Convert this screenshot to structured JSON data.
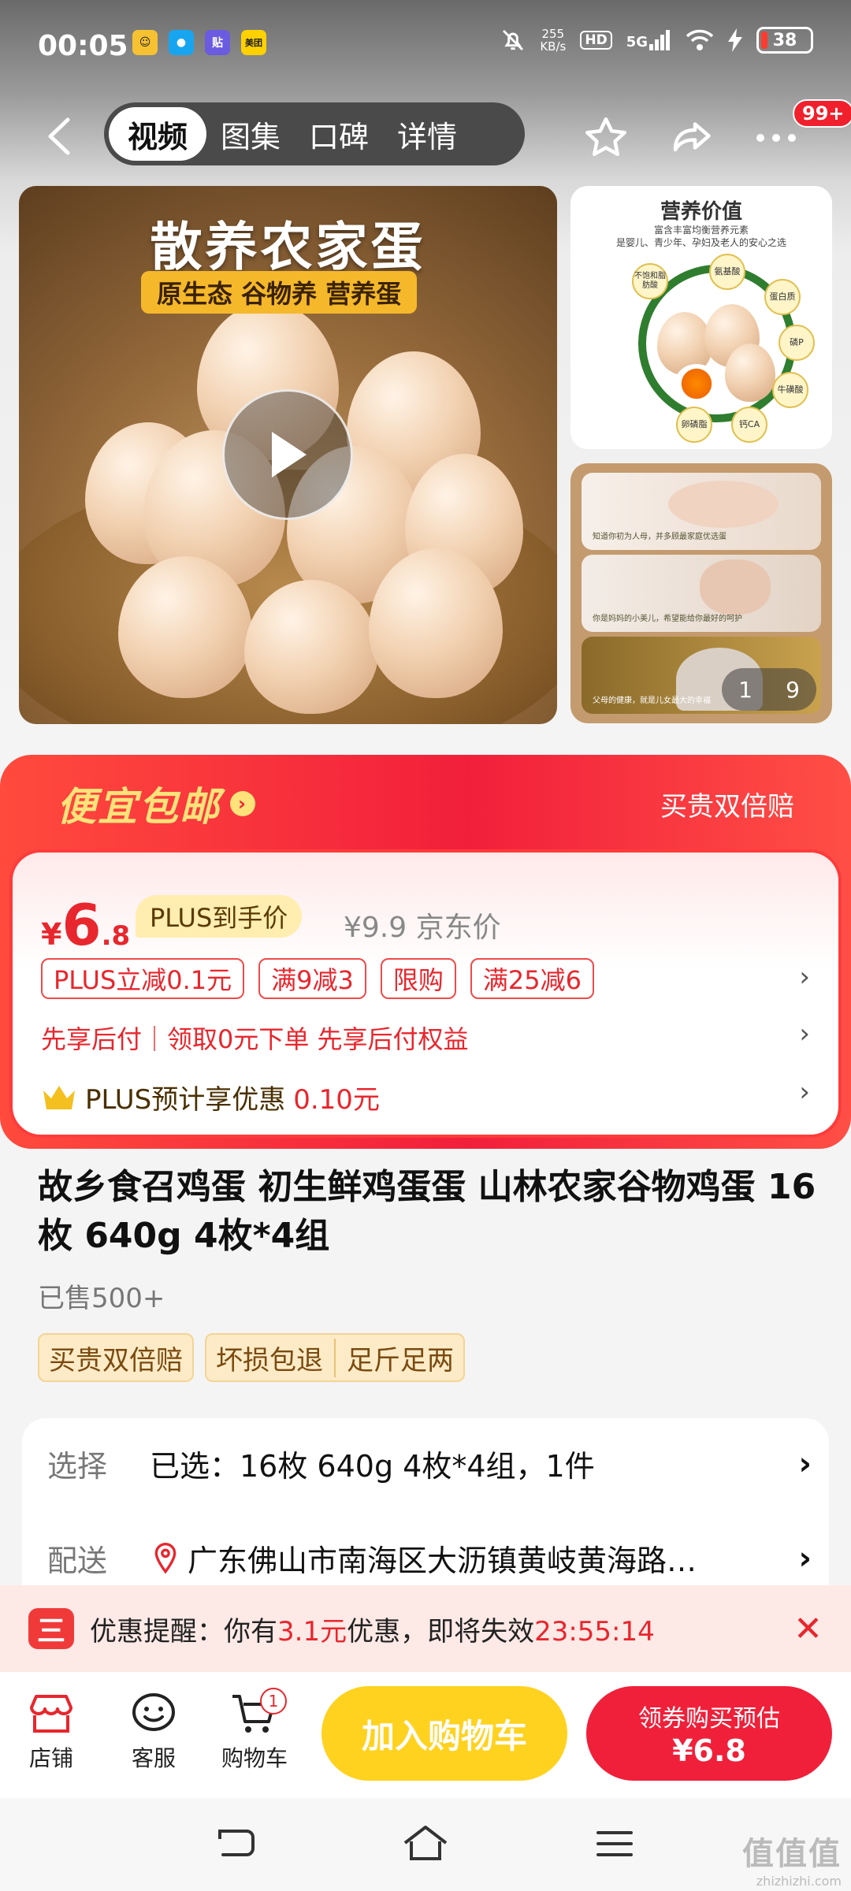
{
  "status_bar": {
    "time": "00:05",
    "apps": [
      {
        "icon": "face-app-icon",
        "glyph": "☺",
        "color": "#f7c231"
      },
      {
        "icon": "penguin-app-icon",
        "glyph": "●",
        "color": "#18a5f0"
      },
      {
        "icon": "tie-app-icon",
        "glyph": "贴",
        "color": "#6a5be0"
      },
      {
        "icon": "meituan-app-icon",
        "glyph": "美团",
        "color": "#ffd100"
      }
    ],
    "net_speed": "255",
    "net_unit": "KB/s",
    "hd": "HD",
    "signal": "5G",
    "battery": "38"
  },
  "header": {
    "tabs": [
      "视频",
      "图集",
      "口碑",
      "详情"
    ],
    "active_tab": 0,
    "badge": "99+"
  },
  "gallery": {
    "main_title": "散养农家蛋",
    "main_subtitle": "原生态 谷物养 营养蛋",
    "side1_title": "营养价值",
    "side1_sub1": "富含丰富均衡营养元素",
    "side1_sub2": "是婴儿、青少年、孕妇及老人的安心之选",
    "nutrients": [
      "氨基酸",
      "蛋白质",
      "磷P",
      "牛磺酸",
      "钙CA",
      "卵磷脂",
      "不饱和脂肪酸"
    ],
    "panel_texts": [
      "知道你初为人母，并多顾最家庭优选蛋",
      "你是妈妈的小美儿，希望能给你最好的呵护",
      "父母的健康，就是儿女最大的幸福"
    ],
    "counter_current": "1",
    "counter_total": "9"
  },
  "promo": {
    "title": "便宜包邮",
    "right_text": "买贵双倍赔"
  },
  "price": {
    "currency": "¥",
    "integer": "6",
    "decimal": ".8",
    "plus_label": "PLUS到手价",
    "jd_price": "¥9.9 京东价",
    "chips": [
      "PLUS立减0.1元",
      "满9减3",
      "限购",
      "满25减6"
    ],
    "bnpl": "先享后付｜领取0元下单 先享后付权益",
    "plus_save_prefix": "PLUS预计享优惠",
    "plus_save_amount": "0.10元"
  },
  "product": {
    "title": "故乡食召鸡蛋 初生鲜鸡蛋蛋 山林农家谷物鸡蛋 16枚 640g 4枚*4组",
    "sold": "已售500+",
    "tags": [
      "买贵双倍赔",
      "坏损包退",
      "足斤足两"
    ]
  },
  "spec": {
    "select_label": "选择",
    "select_value": "已选：16枚 640g 4枚*4组，1件",
    "ship_label": "配送",
    "ship_value": "广东佛山市南海区大沥镇黄岐黄海路…"
  },
  "reminder": {
    "icon_glyph": "三",
    "prefix": "优惠提醒：你有",
    "amount": "3.1元",
    "middle": "优惠，即将失效",
    "countdown": "23:55:14"
  },
  "bottom_bar": {
    "store": "店铺",
    "service": "客服",
    "cart": "购物车",
    "cart_count": "1",
    "add_to_cart": "加入购物车",
    "buy_line1": "领券购买预估",
    "buy_line2": "¥6.8"
  },
  "watermark": {
    "logo": "值值值",
    "site": "zhizhizhi.com"
  },
  "colors": {
    "accent_red": "#e8262d",
    "cart_yellow": "#ffd21f",
    "promo_gold": "#ffe27a"
  }
}
